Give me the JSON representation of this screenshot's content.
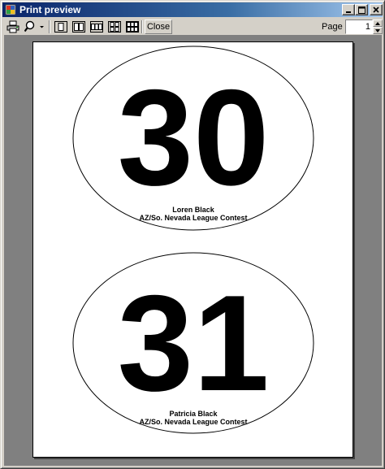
{
  "window": {
    "title": "Print preview"
  },
  "toolbar": {
    "close_label": "Close",
    "page_label": "Page",
    "page_value": "1",
    "icons": [
      "print-icon",
      "zoom-icon",
      "one-page-icon",
      "two-pages-icon",
      "three-pages-icon",
      "four-pages-icon",
      "six-pages-icon"
    ]
  },
  "preview": {
    "labels": [
      {
        "number": "30",
        "name": "Loren Black",
        "event": "AZ/So. Nevada League Contest"
      },
      {
        "number": "31",
        "name": "Patricia Black",
        "event": "AZ/So. Nevada League Contest"
      }
    ]
  },
  "colors": {
    "titlebar_start": "#0a246a",
    "titlebar_end": "#a6caf0",
    "chrome": "#d4d0c8",
    "preview_background": "#808080",
    "page": "#ffffff"
  }
}
